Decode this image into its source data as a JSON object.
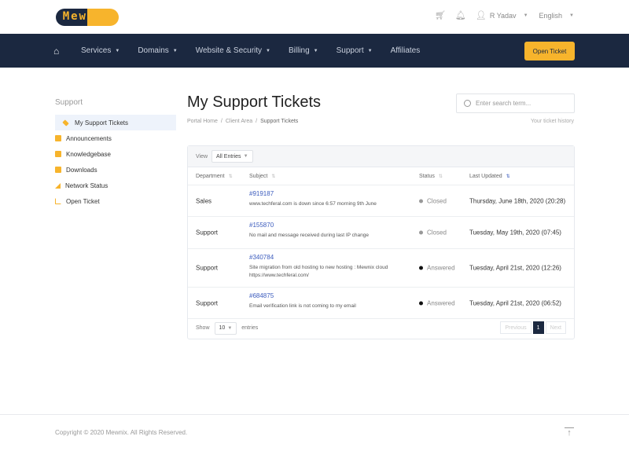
{
  "brand": {
    "name": "MewniX",
    "colors": {
      "navy": "#1b2840",
      "accent": "#f7b42c",
      "link": "#3b5bbd"
    }
  },
  "topbar": {
    "cart_icon": "basket-icon",
    "notifications_icon": "bell-icon",
    "user_icon": "user-icon",
    "user_name": "R Yadav",
    "language": "English"
  },
  "nav": {
    "home_icon": "home-icon",
    "items": [
      {
        "label": "Services",
        "dropdown": true
      },
      {
        "label": "Domains",
        "dropdown": true
      },
      {
        "label": "Website & Security",
        "dropdown": true
      },
      {
        "label": "Billing",
        "dropdown": true
      },
      {
        "label": "Support",
        "dropdown": true
      },
      {
        "label": "Affiliates",
        "dropdown": false
      }
    ],
    "open_ticket_label": "Open Ticket"
  },
  "sidebar": {
    "heading": "Support",
    "items": [
      {
        "label": "My Support Tickets",
        "icon": "ticket-icon",
        "active": true
      },
      {
        "label": "Announcements",
        "icon": "comment-icon",
        "active": false
      },
      {
        "label": "Knowledgebase",
        "icon": "book-icon",
        "active": false
      },
      {
        "label": "Downloads",
        "icon": "download-icon",
        "active": false
      },
      {
        "label": "Network Status",
        "icon": "signal-icon",
        "active": false
      },
      {
        "label": "Open Ticket",
        "icon": "external-link-icon",
        "active": false
      }
    ]
  },
  "page": {
    "title": "My Support Tickets",
    "breadcrumb": [
      "Portal Home",
      "Client Area",
      "Support Tickets"
    ],
    "search_placeholder": "Enter search term...",
    "history_label": "Your ticket history"
  },
  "table": {
    "view_label": "View",
    "view_value": "All Entries",
    "columns": [
      "Department",
      "Subject",
      "Status",
      "Last Updated"
    ],
    "rows": [
      {
        "department": "Sales",
        "id": "#919187",
        "subject": "www.techferal.com is down since 6:57 morning 9th June",
        "status": "Closed",
        "updated": "Thursday, June 18th, 2020 (20:28)"
      },
      {
        "department": "Support",
        "id": "#155870",
        "subject": "No mail and message received during last IP change",
        "status": "Closed",
        "updated": "Tuesday, May 19th, 2020 (07:45)"
      },
      {
        "department": "Support",
        "id": "#340784",
        "subject": "Site migration from old hosting to new hosting : Mewnix cloud https://www.techferal.com/",
        "status": "Answered",
        "updated": "Tuesday, April 21st, 2020 (12:26)"
      },
      {
        "department": "Support",
        "id": "#684875",
        "subject": "Email verification link is not coming to my email",
        "status": "Answered",
        "updated": "Tuesday, April 21st, 2020 (06:52)"
      }
    ],
    "show_label": "Show",
    "page_size": "10",
    "entries_label": "entries",
    "pagination": {
      "previous": "Previous",
      "current": "1",
      "next": "Next"
    }
  },
  "footer": {
    "copyright": "Copyright © 2020 Mewnix. All Rights Reserved.",
    "back_to_top_icon": "arrow-up-to-top-icon"
  }
}
